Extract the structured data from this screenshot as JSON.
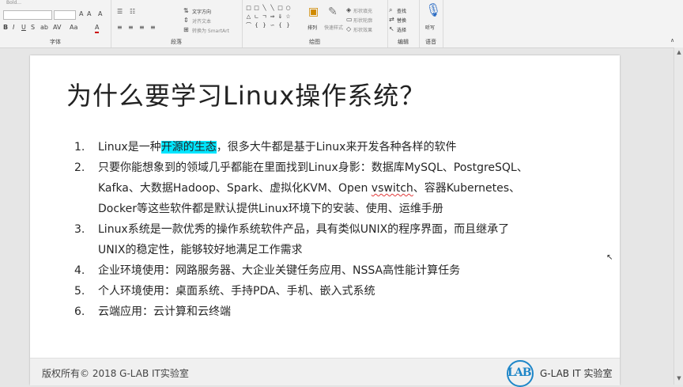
{
  "ribbon": {
    "top_left_fragment": "Bold...",
    "font_group_label": "字体",
    "paragraph_group_label": "段落",
    "drawing_group_label": "绘图",
    "editing_group_label": "编辑",
    "voice_group_label": "语音",
    "text_direction": "文字方向",
    "align_text": "对齐文本",
    "convert_smartart": "转换为 SmartArt",
    "arrange": "排列",
    "quick_styles": "快速样式",
    "shape_fill": "形状填充",
    "shape_outline": "形状轮廓",
    "shape_effects": "形状效果",
    "find": "查找",
    "replace": "替换",
    "select": "选择",
    "dictate": "听写",
    "font_buttons": [
      "B",
      "I",
      "U",
      "S",
      "ab",
      "AV",
      "Aa",
      "A"
    ]
  },
  "slide": {
    "title": "为什么要学习Linux操作系统？",
    "points": [
      {
        "num": "1.",
        "pre": "Linux是一种",
        "highlight": "开源的生态",
        "post": "，很多大牛都是基于Linux来开发各种各样的软件"
      },
      {
        "num": "2.",
        "lines": [
          "只要你能想象到的领域几乎都能在里面找到Linux身影：数据库MySQL、PostgreSQL、",
          "Kafka、大数据Hadoop、Spark、虚拟化KVM、Open ",
          "、容器Kubernetes、",
          "Docker等这些软件都是默认提供Linux环境下的安装、使用、运维手册"
        ],
        "misspelled": "vswitch"
      },
      {
        "num": "3.",
        "lines": [
          "Linux系统是一款优秀的操作系统软件产品，具有类似UNIX的程序界面，而且继承了",
          "UNIX的稳定性，能够较好地满足工作需求"
        ]
      },
      {
        "num": "4.",
        "text": "企业环境使用：网路服务器、大企业关键任务应用、NSSA高性能计算任务"
      },
      {
        "num": "5.",
        "text": "个人环境使用：桌面系统、手持PDA、手机、嵌入式系统"
      },
      {
        "num": "6.",
        "text": "云端应用：云计算和云终端"
      }
    ],
    "footer": {
      "copyright": "版权所有© 2018 G-LAB IT实验室",
      "logo_text": "LAB",
      "lab_name": "G-LAB IT 实验室"
    }
  },
  "colors": {
    "highlight": "#00e5ff",
    "logo_blue": "#1e86c8"
  }
}
